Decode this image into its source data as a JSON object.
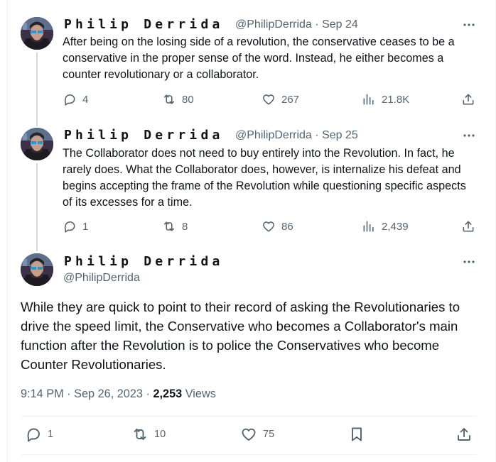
{
  "tweets": [
    {
      "display_name": "Philip Derrida",
      "handle": "@PhilipDerrida",
      "date": "Sep 24",
      "text": "After being on the losing side of a revolution, the conservative ceases to be a conservative in the proper sense of the word. Instead, he either becomes a counter revolutionary or a collaborator.",
      "replies": "4",
      "reposts": "80",
      "likes": "267",
      "views": "21.8K"
    },
    {
      "display_name": "Philip Derrida",
      "handle": "@PhilipDerrida",
      "date": "Sep 25",
      "text": "The Collaborator does not need to buy entirely into the Revolution. In fact, he rarely does. What the Collaborator does, however, is internalize his defeat and begins accepting the frame of the Revolution while questioning specific aspects of its excesses for a time.",
      "replies": "1",
      "reposts": "8",
      "likes": "86",
      "views": "2,439"
    }
  ],
  "main_tweet": {
    "display_name": "Philip Derrida",
    "handle": "@PhilipDerrida",
    "text": "While they are quick to point to their record of asking the Revolutionaries to drive the speed limit, the Conservative who becomes a Collaborator's main function after the Revolution is to police the Conservatives who become Counter Revolutionaries.",
    "time": "9:14 PM · Sep 26, 2023 · ",
    "views_count": "2,253",
    "views_label": " Views",
    "replies": "1",
    "reposts": "10",
    "likes": "75"
  },
  "icons": [
    "more-icon",
    "reply-icon",
    "repost-icon",
    "like-icon",
    "views-icon",
    "share-icon",
    "bookmark-icon"
  ],
  "colors": {
    "text": "#0f1419",
    "secondary": "#536471",
    "thread_line": "#cfd9de",
    "divider": "#eff3f4"
  }
}
